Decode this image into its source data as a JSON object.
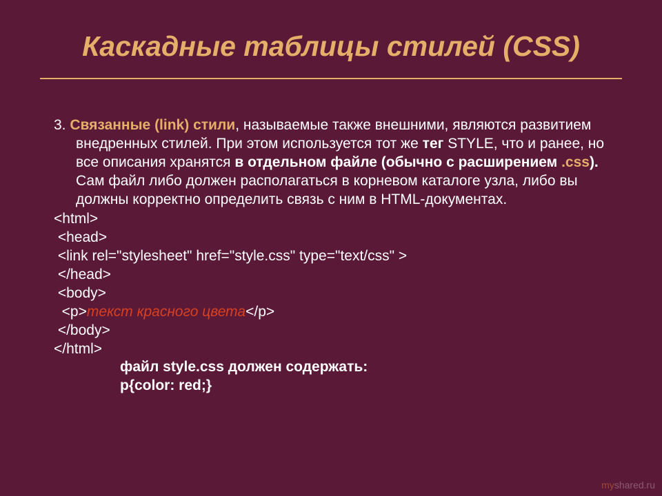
{
  "title": "Каскадные таблицы стилей (CSS)",
  "number": "3.",
  "lead_bold": "Связанные (link) стили",
  "p1_a": ", называемые также внешними, являются развитием внедренных стилей. При этом используется тот же ",
  "p1_tag": "тег",
  "p1_b": " STYLE, что и ранее, но все описания хранятся ",
  "p1_bold2": "в отдельном файле (обычно с расширением ",
  "p1_css": ".css",
  "p1_bold3": ").",
  "p1_c": " Сам файл либо должен располагаться в корневом каталоге узла, либо вы должны корректно определить связь с ним в HTML-документах.",
  "code": {
    "l1": "<html>",
    "l2": " <head>",
    "l3": " <link rel=\"stylesheet\" href=\"style.css\" type=\"text/css\" >",
    "l4": " </head>",
    "l5": " <body>",
    "l6a": "  <p>",
    "l6b": "текст красного цвета",
    "l6c": "</p>",
    "l7": " </body>",
    "l8": "</html>"
  },
  "footer": {
    "f1": "файл style.css должен содержать:",
    "f2": "p{color: red;}"
  },
  "watermark": {
    "my": "my",
    "rest": "shared.ru"
  }
}
